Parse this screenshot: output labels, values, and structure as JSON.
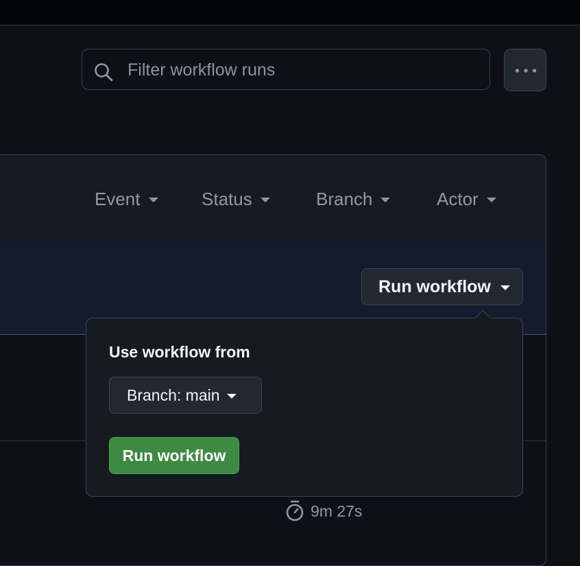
{
  "search": {
    "placeholder": "Filter workflow runs",
    "icon": "search-icon"
  },
  "more_options": {
    "icon": "kebab-horizontal-icon"
  },
  "filters": [
    {
      "label": "Event"
    },
    {
      "label": "Status"
    },
    {
      "label": "Branch"
    },
    {
      "label": "Actor"
    }
  ],
  "run_workflow": {
    "label": "Run workflow"
  },
  "popover": {
    "title": "Use workflow from",
    "branch_label": "Branch: main",
    "submit_label": "Run workflow"
  },
  "run_row": {
    "duration": "9m 27s",
    "icon": "stopwatch-icon"
  },
  "colors": {
    "background": "#0d1117",
    "primary_button": "#3d8a42",
    "banner": "#141b2c"
  }
}
